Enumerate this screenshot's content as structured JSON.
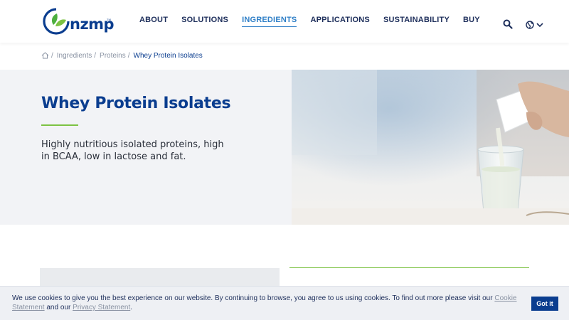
{
  "brand": {
    "logo_text": "nzmp",
    "trademark": "TM",
    "primary_color": "#0a3d8f",
    "accent_green": "#7cc242",
    "active_nav_color": "#2f7fc7"
  },
  "nav": {
    "items": [
      {
        "label": "ABOUT"
      },
      {
        "label": "SOLUTIONS"
      },
      {
        "label": "INGREDIENTS",
        "active": true
      },
      {
        "label": "APPLICATIONS"
      },
      {
        "label": "SUSTAINABILITY"
      },
      {
        "label": "BUY"
      }
    ],
    "search_icon": "search-icon",
    "language_icon": "globe-icon"
  },
  "breadcrumb": {
    "home_icon": "home-icon",
    "items": [
      "Ingredients",
      "Proteins"
    ],
    "current": "Whey Protein Isolates",
    "separator": "/"
  },
  "hero": {
    "title": "Whey Protein Isolates",
    "description": "Highly nutritious isolated proteins, high in BCAA, low in lactose and fat."
  },
  "cookie_banner": {
    "text_before": "We use cookies to give you the best experience on our website. By continuing to browse, you agree to us using cookies. To find out more please visit our ",
    "link1": "Cookie Statement",
    "text_middle": " and our ",
    "link2": "Privacy Statement",
    "text_after": ".",
    "button_label": "Got it"
  }
}
